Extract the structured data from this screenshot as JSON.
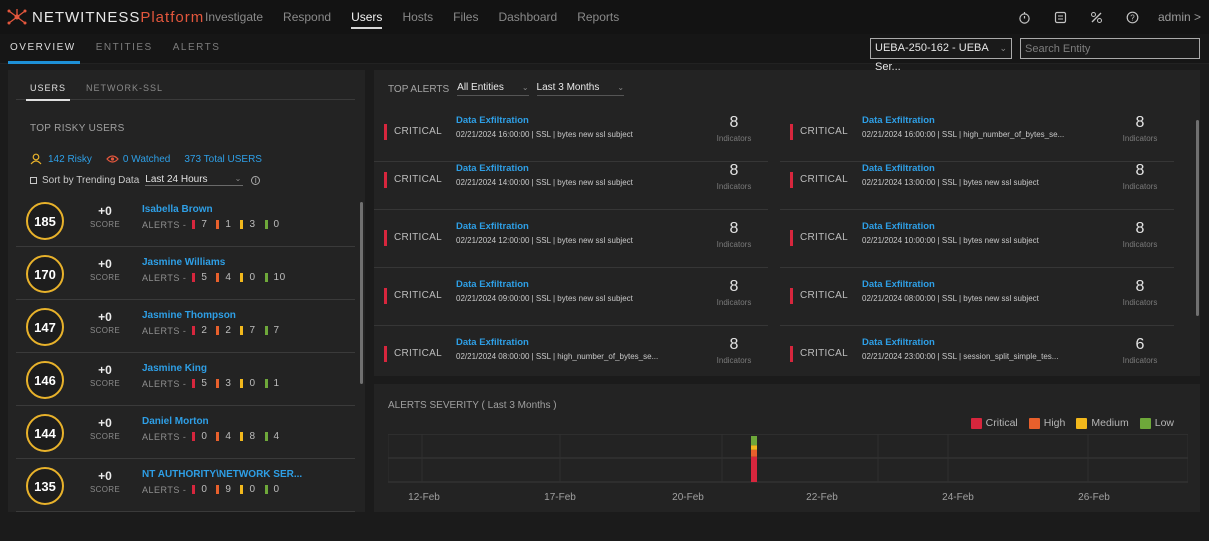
{
  "brand": {
    "name": "NETWITNESS",
    "suffix": "Platform"
  },
  "nav": {
    "items": [
      "Investigate",
      "Respond",
      "Users",
      "Hosts",
      "Files",
      "Dashboard",
      "Reports"
    ],
    "active": "Users",
    "user": "admin >"
  },
  "subnav": {
    "tabs": [
      "OVERVIEW",
      "ENTITIES",
      "ALERTS"
    ],
    "active": "OVERVIEW"
  },
  "entity_select": "UEBA-250-162 - UEBA Ser...",
  "search": {
    "placeholder": "Search Entity"
  },
  "left": {
    "tabs": [
      "USERS",
      "NETWORK-SSL"
    ],
    "title": "TOP RISKY USERS",
    "risky": "142 Risky",
    "watched": "0 Watched",
    "total": "373 Total USERS",
    "sort_label": "Sort by Trending Data",
    "period": "Last 24 Hours",
    "score_label": "SCORE",
    "alerts_label": "ALERTS -",
    "users": [
      {
        "score": "185",
        "delta": "+0",
        "name": "Isabella Brown",
        "alerts": [
          "7",
          "1",
          "3",
          "0"
        ]
      },
      {
        "score": "170",
        "delta": "+0",
        "name": "Jasmine Williams",
        "alerts": [
          "5",
          "4",
          "0",
          "10"
        ]
      },
      {
        "score": "147",
        "delta": "+0",
        "name": "Jasmine Thompson",
        "alerts": [
          "2",
          "2",
          "7",
          "7"
        ]
      },
      {
        "score": "146",
        "delta": "+0",
        "name": "Jasmine King",
        "alerts": [
          "5",
          "3",
          "0",
          "1"
        ]
      },
      {
        "score": "144",
        "delta": "+0",
        "name": "Daniel Morton",
        "alerts": [
          "0",
          "4",
          "8",
          "4"
        ]
      },
      {
        "score": "135",
        "delta": "+0",
        "name": "NT AUTHORITY\\NETWORK SER...",
        "alerts": [
          "0",
          "9",
          "0",
          "0"
        ]
      }
    ]
  },
  "top_alerts": {
    "title": "TOP ALERTS",
    "entity_filter": "All Entities",
    "time_filter": "Last 3 Months",
    "indicators_label": "Indicators",
    "items": [
      {
        "severity": "CRITICAL",
        "name": "Data Exfiltration",
        "meta": "02/21/2024 16:00:00  |  SSL  |  bytes new ssl subject",
        "count": "8"
      },
      {
        "severity": "CRITICAL",
        "name": "Data Exfiltration",
        "meta": "02/21/2024 16:00:00  |  SSL  |  high_number_of_bytes_se...",
        "count": "8"
      },
      {
        "severity": "CRITICAL",
        "name": "Data Exfiltration",
        "meta": "02/21/2024 14:00:00  |  SSL  |  bytes new ssl subject",
        "count": "8"
      },
      {
        "severity": "CRITICAL",
        "name": "Data Exfiltration",
        "meta": "02/21/2024 13:00:00  |  SSL  |  bytes new ssl subject",
        "count": "8"
      },
      {
        "severity": "CRITICAL",
        "name": "Data Exfiltration",
        "meta": "02/21/2024 12:00:00  |  SSL  |  bytes new ssl subject",
        "count": "8"
      },
      {
        "severity": "CRITICAL",
        "name": "Data Exfiltration",
        "meta": "02/21/2024 10:00:00  |  SSL  |  bytes new ssl subject",
        "count": "8"
      },
      {
        "severity": "CRITICAL",
        "name": "Data Exfiltration",
        "meta": "02/21/2024 09:00:00  |  SSL  |  bytes new ssl subject",
        "count": "8"
      },
      {
        "severity": "CRITICAL",
        "name": "Data Exfiltration",
        "meta": "02/21/2024 08:00:00  |  SSL  |  bytes new ssl subject",
        "count": "8"
      },
      {
        "severity": "CRITICAL",
        "name": "Data Exfiltration",
        "meta": "02/21/2024 08:00:00  |  SSL  |  high_number_of_bytes_se...",
        "count": "8"
      },
      {
        "severity": "CRITICAL",
        "name": "Data Exfiltration",
        "meta": "02/21/2024 23:00:00  |  SSL  |  session_split_simple_tes...",
        "count": "6"
      }
    ]
  },
  "severity_chart": {
    "title": "ALERTS SEVERITY ( Last 3 Months )",
    "legend": [
      {
        "name": "Critical",
        "color": "#d7263d"
      },
      {
        "name": "High",
        "color": "#e8602c"
      },
      {
        "name": "Medium",
        "color": "#f2b81c"
      },
      {
        "name": "Low",
        "color": "#6ea83a"
      }
    ]
  },
  "colors": {
    "accent": "#1e90d6",
    "link": "#2e9fe6",
    "score_ring": "#e8b22b"
  },
  "chart_data": {
    "type": "bar",
    "title": "ALERTS SEVERITY ( Last 3 Months )",
    "x_tick_labels": [
      "12-Feb",
      "17-Feb",
      "20-Feb",
      "22-Feb",
      "24-Feb",
      "26-Feb"
    ],
    "categories": [
      "21-Feb"
    ],
    "series": [
      {
        "name": "Critical",
        "values": [
          11
        ]
      },
      {
        "name": "High",
        "values": [
          3
        ]
      },
      {
        "name": "Medium",
        "values": [
          2
        ]
      },
      {
        "name": "Low",
        "values": [
          4
        ]
      }
    ],
    "stacked": true,
    "grid": true,
    "legend_position": "top-right"
  }
}
